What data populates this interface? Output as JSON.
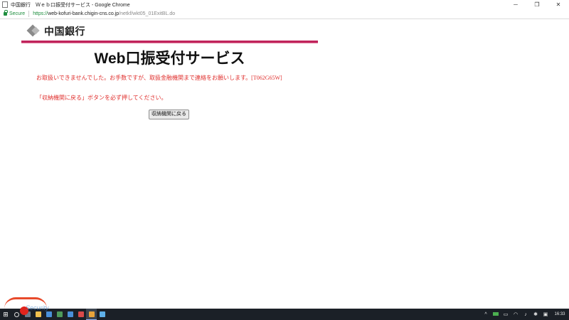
{
  "window": {
    "title": "中国銀行　Ｗｅｂ口振受付サービス - Google Chrome",
    "controls": {
      "minimize": "─",
      "maximize": "❐",
      "close": "✕"
    }
  },
  "address_bar": {
    "secure_label": "Secure",
    "url_scheme": "https://",
    "url_host": "web-kofuri-bank.chigin-cns.co.jp",
    "url_path": "/netkf/wkt05_01ExitBL.do"
  },
  "header": {
    "logo_text": "中国銀行",
    "page_title": "Web口振受付サービス"
  },
  "main": {
    "error_message": "お取扱いできませんでした。お手数ですが、取扱金融機関まで連絡をお願いします。[T062G65W]",
    "instruction": "「収納機関に戻る」ボタンを必ず押してください。",
    "back_button_label": "収納機関に戻る"
  },
  "taskbar": {
    "clock": "16:33",
    "apps": [
      {
        "icon": "task-view-icon",
        "color": "#6a7a8a"
      },
      {
        "icon": "file-explorer-icon",
        "color": "#f2c14e"
      },
      {
        "icon": "terminal-icon",
        "color": "#4a90d9"
      },
      {
        "icon": "app-icon",
        "color": "#4e9a5a"
      },
      {
        "icon": "app-icon",
        "color": "#4a90d9"
      },
      {
        "icon": "app-icon",
        "color": "#d94a4a"
      },
      {
        "icon": "chrome-icon",
        "color": "#e8a33a"
      },
      {
        "icon": "chat-icon",
        "color": "#5fb0e8"
      }
    ],
    "tray_icons": [
      "chevron-up-icon",
      "battery-icon",
      "network-icon",
      "wifi-icon",
      "volume-icon",
      "settings-icon",
      "notification-icon"
    ]
  },
  "watermark": {
    "text": "Security"
  }
}
